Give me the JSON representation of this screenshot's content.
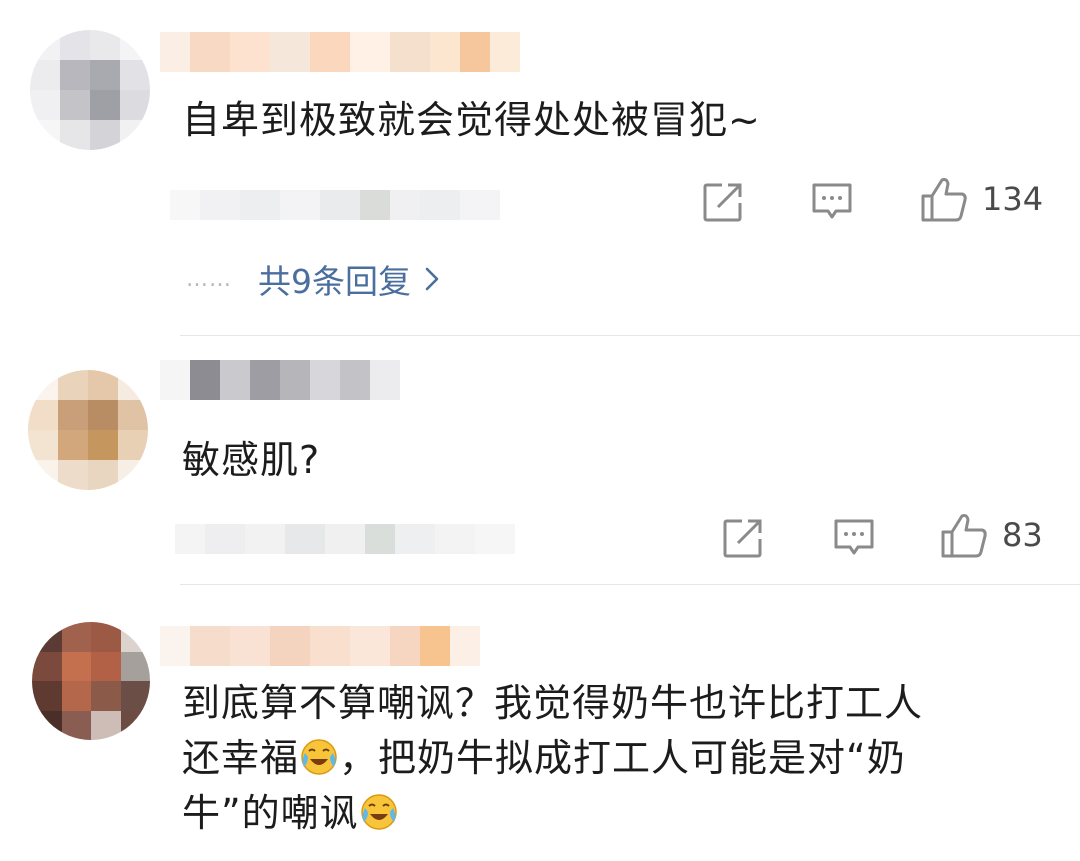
{
  "comments": [
    {
      "text": "自卑到极致就会觉得处处被冒犯~",
      "likes": "134",
      "replies_link": "共9条回复",
      "replies_dots": "……"
    },
    {
      "text": "敏感肌?",
      "likes": "83"
    },
    {
      "text_line1": "到底算不算嘲讽？我觉得奶牛也许比打工人",
      "text_line2_a": "还幸福",
      "text_line2_b": "，把奶牛拟成打工人可能是对“奶",
      "text_line3_a": "牛”的嘲讽"
    }
  ],
  "icons": {
    "share": "share-icon",
    "comment": "comment-icon",
    "like": "thumbs-up-icon",
    "emoji": "laughing-crying-emoji",
    "chevron": "chevron-right-icon"
  },
  "colors": {
    "link": "#4a6f9e",
    "icon": "#8a8a8a",
    "text": "#1c1c1c"
  }
}
